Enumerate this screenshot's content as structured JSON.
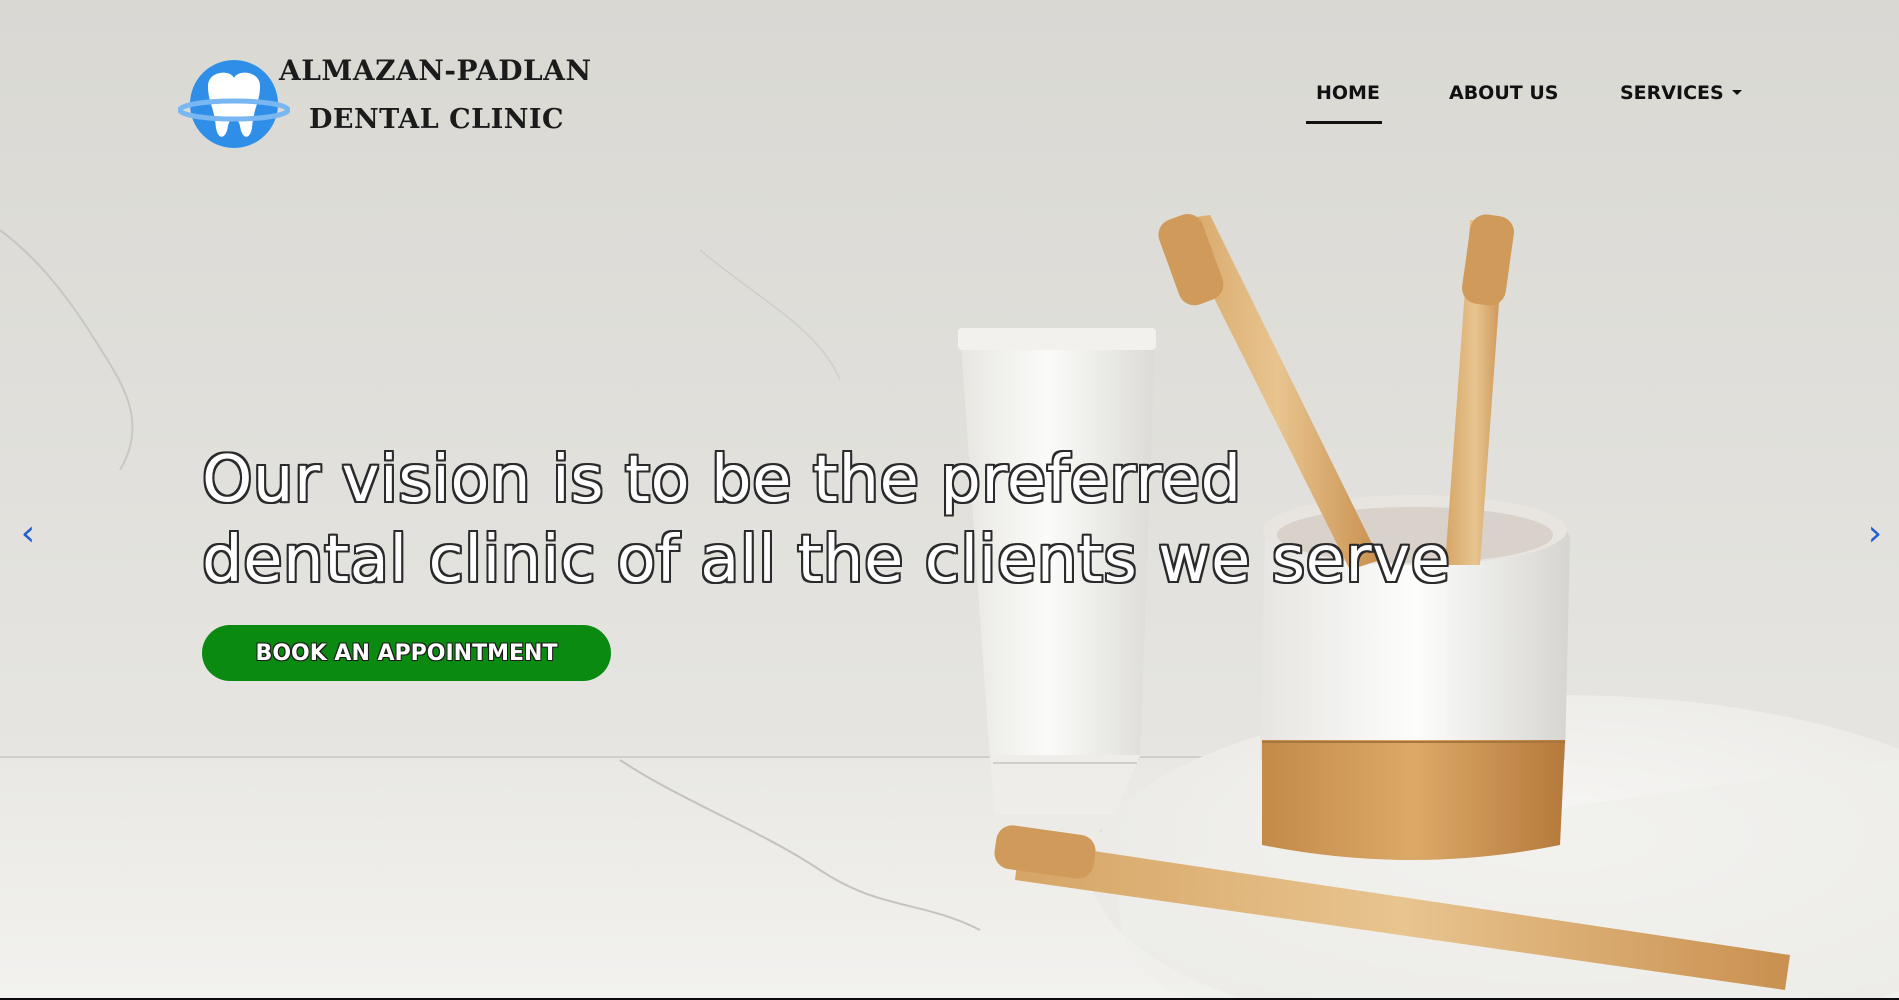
{
  "brand": {
    "name_line1": "ALMAZAN-PADLAN",
    "name_line2": "DENTAL CLINIC",
    "logo_icon": "tooth-icon",
    "logo_color": "#2f8fe8"
  },
  "nav": {
    "items": [
      {
        "label": "HOME",
        "active": true
      },
      {
        "label": "ABOUT US",
        "active": false
      },
      {
        "label": "SERVICES",
        "active": false,
        "has_dropdown": true
      }
    ]
  },
  "carousel": {
    "prev_icon": "chevron-left-icon",
    "next_icon": "chevron-right-icon",
    "prev_glyph": "‹",
    "next_glyph": "›",
    "arrow_color": "#1f5ed3",
    "caption_line1": "Our vision is to be the preferred",
    "caption_line2": "dental clinic of all the clients we serve",
    "cta_label": "BOOK AN APPOINTMENT",
    "cta_color": "#0a8a10"
  }
}
